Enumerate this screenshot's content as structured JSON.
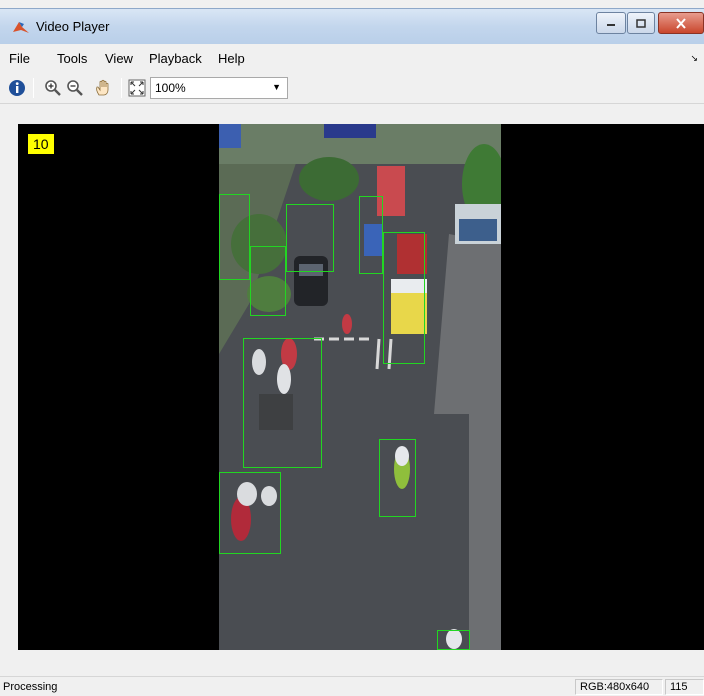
{
  "window": {
    "title": "Video Player"
  },
  "menu": {
    "items": [
      "File",
      "Tools",
      "View",
      "Playback",
      "Help"
    ]
  },
  "toolbar": {
    "zoom": "100%",
    "icons": [
      "info-icon",
      "zoom-in-icon",
      "zoom-out-icon",
      "pan-hand-icon",
      "fit-to-window-icon"
    ]
  },
  "video": {
    "frame_number": "10",
    "detection_color": "#22d622"
  },
  "status": {
    "text": "Processing",
    "format": "RGB:480x640",
    "frame": "115"
  }
}
